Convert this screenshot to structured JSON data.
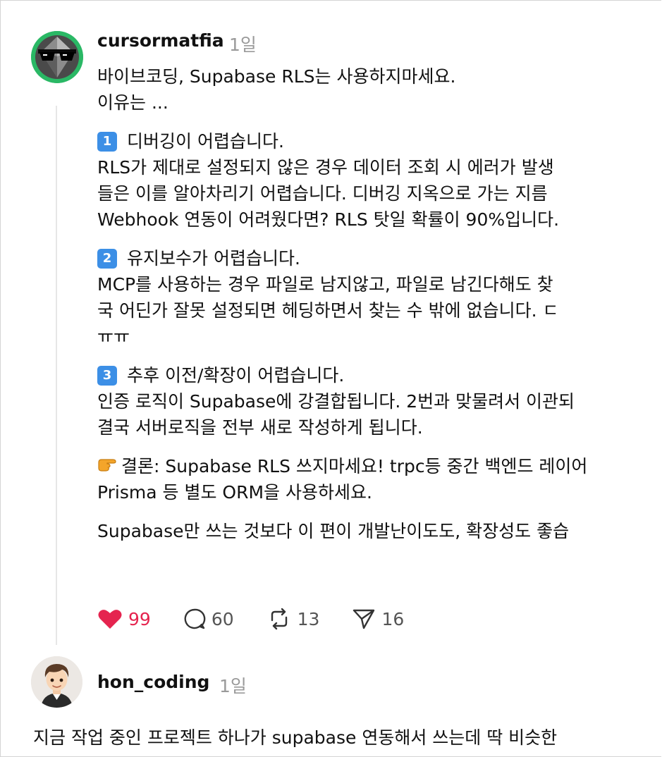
{
  "post": {
    "username": "cursormatfia",
    "time": "1일",
    "lines": {
      "l1": "바이브코딩, Supabase RLS는 사용하지마세요.",
      "l2": "이유는 ...",
      "s1_title": "디버깅이 어렵습니다.",
      "s1_l1": "RLS가 제대로 설정되지 않은 경우 데이터 조회 시 에러가 발생",
      "s1_l2": "들은 이를 알아차리기 어렵습니다. 디버깅 지옥으로 가는 지름",
      "s1_l3": "Webhook 연동이 어려웠다면? RLS 탓일 확률이 90%입니다.",
      "s2_title": "유지보수가 어렵습니다.",
      "s2_l1": "MCP를 사용하는 경우 파일로 남지않고, 파일로 남긴다해도 찾",
      "s2_l2": "국 어딘가 잘못 설정되면 헤딩하면서 찾는 수 밖에 없습니다. ㄷ",
      "s2_l3": "ㅠㅠ",
      "s3_title": "추후 이전/확장이 어렵습니다.",
      "s3_l1": "인증 로직이 Supabase에 강결합됩니다. 2번과 맞물려서 이관되",
      "s3_l2": "결국 서버로직을 전부 새로 작성하게 됩니다.",
      "c_l1": "결론: Supabase RLS 쓰지마세요! trpc등 중간 백엔드 레이어",
      "c_l2": "Prisma 등 별도 ORM을 사용하세요.",
      "last": "Supabase만 쓰는 것보다 이 편이 개발난이도도, 확장성도 좋습"
    },
    "badges": {
      "b1": "1",
      "b2": "2",
      "b3": "3"
    },
    "actions": {
      "likes": "99",
      "comments": "60",
      "reposts": "13",
      "shares": "16"
    },
    "colors": {
      "like": "#e5244f",
      "badge": "#3c8fe6",
      "avatar_ring": "#2ab865"
    }
  },
  "reply": {
    "username": "hon_coding",
    "time": "1일",
    "text": "지금 작업 중인 프로젝트 하나가 supabase 연동해서 쓰는데 딱 비슷한"
  },
  "icons": {
    "post_avatar": "sunglasses-avatar-icon",
    "reply_avatar": "cartoon-person-avatar-icon",
    "like": "heart-icon",
    "comment": "comment-bubble-icon",
    "repost": "repost-icon",
    "share": "send-icon",
    "pointing": "pointing-hand-emoji"
  }
}
